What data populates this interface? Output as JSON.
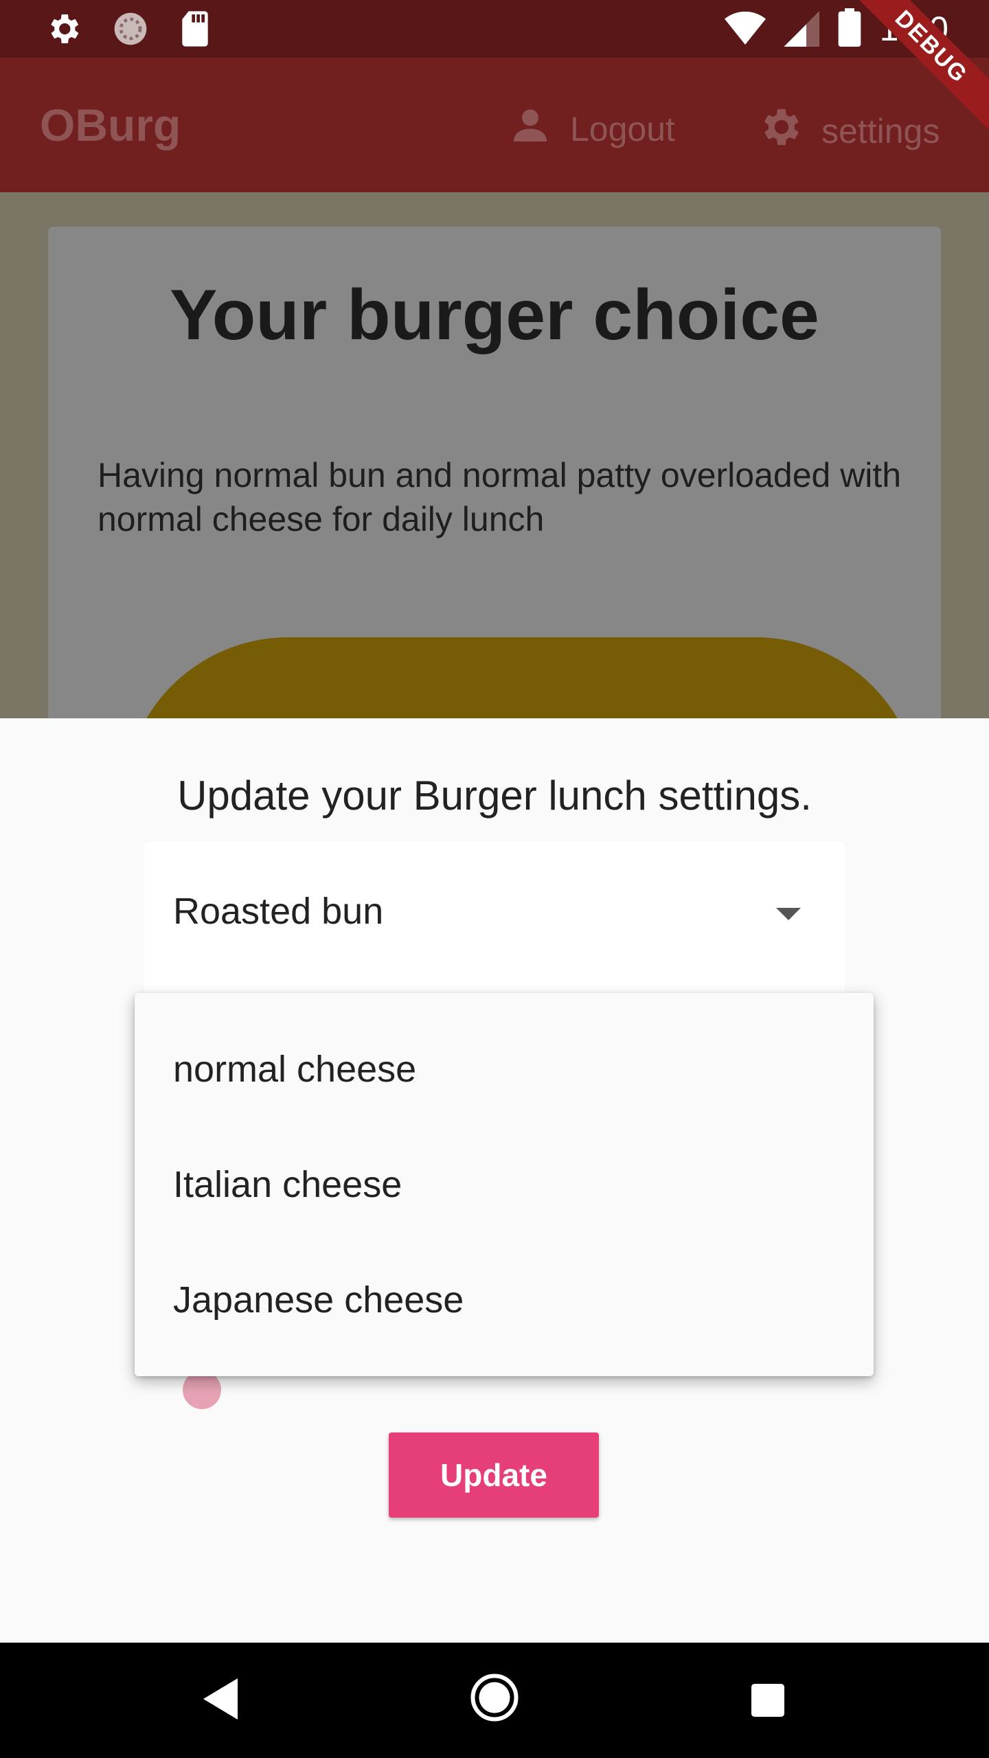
{
  "status_bar": {
    "time": "1:00",
    "left_icons": [
      "settings-icon",
      "sync-icon",
      "sd-card-icon"
    ],
    "right_icons": [
      "wifi-icon",
      "signal-icon",
      "battery-icon"
    ]
  },
  "debug_banner": "DEBUG",
  "app_bar": {
    "title": "OBurg",
    "logout_label": "Logout",
    "settings_label": "settings"
  },
  "card": {
    "heading": "Your burger choice",
    "description": "Having normal bun  and normal patty overloaded with normal cheese for daily lunch"
  },
  "sheet": {
    "title": "Update your Burger lunch settings.",
    "selected_bun": "Roasted bun",
    "update_label": "Update"
  },
  "dropdown_menu": {
    "options": [
      "normal cheese",
      "Italian cheese",
      "Japanese cheese"
    ]
  },
  "colors": {
    "status_bar": "#5a1718",
    "app_bar": "#721f1f",
    "accent_button": "#e63e78",
    "bun": "#765d05"
  }
}
